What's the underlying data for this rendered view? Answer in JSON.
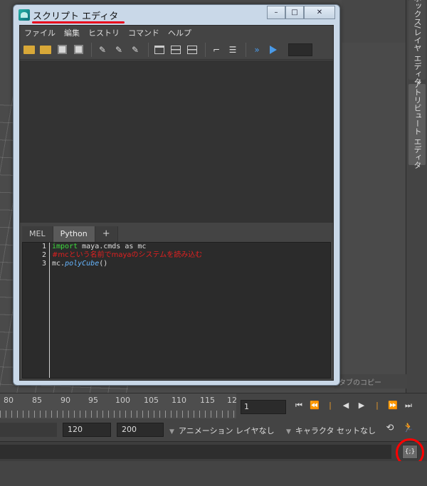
{
  "window": {
    "title": "スクリプト エディタ",
    "controls": {
      "minimize": "–",
      "maximize": "□",
      "close": "✕"
    }
  },
  "menubar": [
    "ファイル",
    "編集",
    "ヒストリ",
    "コマンド",
    "ヘルプ"
  ],
  "side_tabs": [
    "ボックス/レイヤ エディタ",
    "アトリビュート エディタ"
  ],
  "editor_tabs": {
    "mel": "MEL",
    "python": "Python",
    "add": "+",
    "active": "Python"
  },
  "code_lines": [
    {
      "num": "1",
      "kw": "import",
      "rest": " maya.cmds as mc"
    },
    {
      "num": "2",
      "comment": "#mcという名前でmayaのシステムを読み込む"
    },
    {
      "num": "3",
      "pre": "mc.",
      "fn": "polyCube",
      "post": "()"
    }
  ],
  "copy_tab": "タブのコピー",
  "timeline": {
    "ticks": [
      "80",
      "85",
      "90",
      "95",
      "100",
      "105",
      "110",
      "115",
      "12"
    ],
    "current_frame": "1",
    "controls": [
      "⏮",
      "⏪",
      "|",
      "◀",
      "▶",
      "|",
      "⏩",
      "⏭"
    ]
  },
  "range": {
    "end": "120",
    "anim_end": "200",
    "anim_layer": "アニメーション レイヤなし",
    "character_set": "キャラクタ セットなし"
  },
  "command_line": {
    "script_editor_button": "{;}"
  },
  "colors": {
    "annotation": "#e8001c",
    "python_keyword": "#3ddb3d",
    "comment": "#e02020",
    "function": "#66b6ff"
  }
}
